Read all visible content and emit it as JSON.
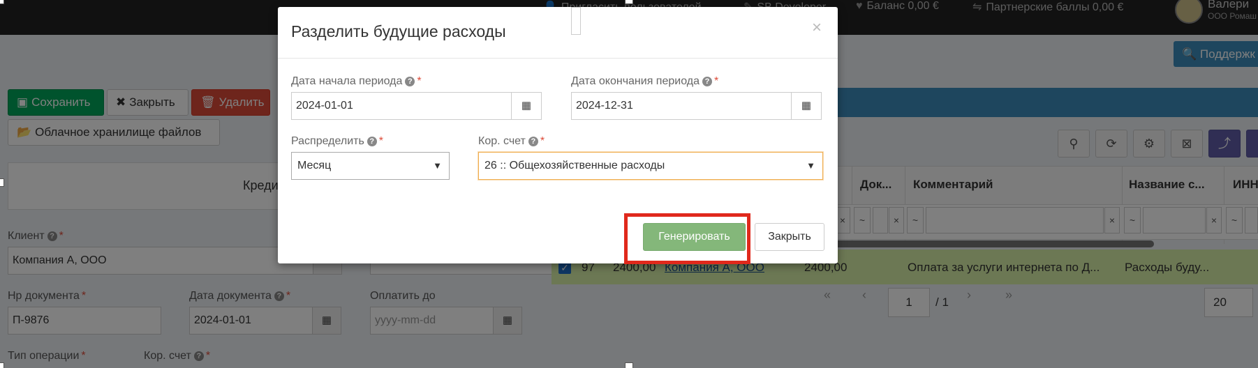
{
  "topbar": {
    "invite": "Пригласить пользователей",
    "developer": "SB Developer",
    "balance": "Баланс 0,00 €",
    "partner_points": "Партнерские баллы 0,00 €",
    "user_name": "Валери",
    "user_org": "ООО Ромаш"
  },
  "support_label": "Поддержк",
  "toolbar": {
    "save": "Сохранить",
    "close": "Закрыть",
    "delete": "Удалить",
    "cloud": "Облачное хранилище файлов"
  },
  "panel_title": "Креди",
  "form": {
    "client_label": "Клиент",
    "client_value": "Компания А, ООО",
    "doc_no_label": "Нр документа",
    "doc_no_value": "П-9876",
    "doc_date_label": "Дата документа",
    "doc_date_value": "2024-01-01",
    "pay_until_label": "Оплатить до",
    "pay_until_placeholder": "yyyy-mm-dd",
    "op_type_label": "Тип операции",
    "account_label": "Кор. счет"
  },
  "grid": {
    "headers": {
      "doc": "Док...",
      "comment": "Комментарий",
      "name": "Название с...",
      "inn": "ИНН"
    },
    "filter_tilde": "~",
    "filter_x": "×",
    "row": {
      "checked": true,
      "id": "97",
      "amount": "2400,00",
      "client": "Компания А, ООО",
      "amount2": "2400,00",
      "comment": "Оплата за услуги интернета по Д...",
      "name": "Расходы буду..."
    },
    "pager": {
      "page": "1",
      "of": "/ 1",
      "page_size": "20"
    }
  },
  "modal": {
    "title": "Разделить будущие расходы",
    "start_label": "Дата начала периода",
    "start_value": "2024-01-01",
    "end_label": "Дата окончания периода",
    "end_value": "2024-12-31",
    "distribute_label": "Распределить",
    "distribute_value": "Месяц",
    "account_label": "Кор. счет",
    "account_value": "26 :: Общехозяйственные расходы",
    "generate": "Генерировать",
    "close": "Закрыть"
  },
  "colors": {
    "accent_blue": "#3c8dbc",
    "generate_green": "#84b77a",
    "highlight_red": "#e0291c",
    "row_highlight": "#d8f0a8"
  }
}
